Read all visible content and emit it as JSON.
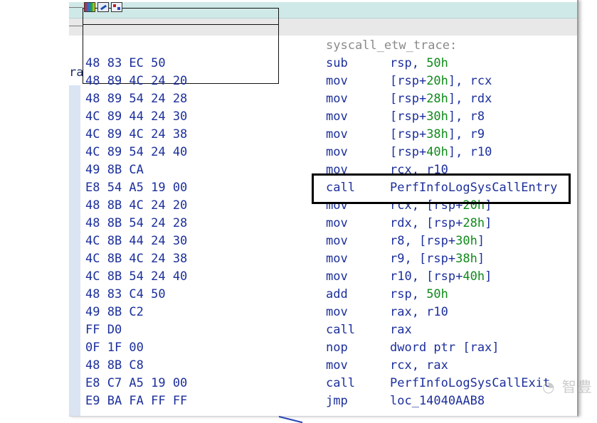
{
  "fragment": {
    "left_text": "ra"
  },
  "function_label": "syscall_etw_trace:",
  "instructions": [
    {
      "bytes": "48 83 EC 50",
      "mnemonic": "sub",
      "ops": [
        {
          "t": "rsp, "
        },
        {
          "t": "50h",
          "num": true
        }
      ]
    },
    {
      "bytes": "48 89 4C 24 20",
      "mnemonic": "mov",
      "ops": [
        {
          "t": "[rsp+"
        },
        {
          "t": "20h",
          "num": true
        },
        {
          "t": "], rcx"
        }
      ]
    },
    {
      "bytes": "48 89 54 24 28",
      "mnemonic": "mov",
      "ops": [
        {
          "t": "[rsp+"
        },
        {
          "t": "28h",
          "num": true
        },
        {
          "t": "], rdx"
        }
      ]
    },
    {
      "bytes": "4C 89 44 24 30",
      "mnemonic": "mov",
      "ops": [
        {
          "t": "[rsp+"
        },
        {
          "t": "30h",
          "num": true
        },
        {
          "t": "], r8"
        }
      ]
    },
    {
      "bytes": "4C 89 4C 24 38",
      "mnemonic": "mov",
      "ops": [
        {
          "t": "[rsp+"
        },
        {
          "t": "38h",
          "num": true
        },
        {
          "t": "], r9"
        }
      ]
    },
    {
      "bytes": "4C 89 54 24 40",
      "mnemonic": "mov",
      "ops": [
        {
          "t": "[rsp+"
        },
        {
          "t": "40h",
          "num": true
        },
        {
          "t": "], r10"
        }
      ]
    },
    {
      "bytes": "49 8B CA",
      "mnemonic": "mov",
      "ops": [
        {
          "t": "rcx, r10"
        }
      ]
    },
    {
      "bytes": "E8 54 A5 19 00",
      "mnemonic": "call",
      "ops": [
        {
          "t": "PerfInfoLogSysCallEntry"
        }
      ]
    },
    {
      "bytes": "48 8B 4C 24 20",
      "mnemonic": "mov",
      "ops": [
        {
          "t": "rcx, [rsp+"
        },
        {
          "t": "20h",
          "num": true
        },
        {
          "t": "]"
        }
      ]
    },
    {
      "bytes": "48 8B 54 24 28",
      "mnemonic": "mov",
      "ops": [
        {
          "t": "rdx, [rsp+"
        },
        {
          "t": "28h",
          "num": true
        },
        {
          "t": "]"
        }
      ]
    },
    {
      "bytes": "4C 8B 44 24 30",
      "mnemonic": "mov",
      "ops": [
        {
          "t": "r8, [rsp+"
        },
        {
          "t": "30h",
          "num": true
        },
        {
          "t": "]"
        }
      ]
    },
    {
      "bytes": "4C 8B 4C 24 38",
      "mnemonic": "mov",
      "ops": [
        {
          "t": "r9, [rsp+"
        },
        {
          "t": "38h",
          "num": true
        },
        {
          "t": "]"
        }
      ]
    },
    {
      "bytes": "4C 8B 54 24 40",
      "mnemonic": "mov",
      "ops": [
        {
          "t": "r10, [rsp+"
        },
        {
          "t": "40h",
          "num": true
        },
        {
          "t": "]"
        }
      ]
    },
    {
      "bytes": "48 83 C4 50",
      "mnemonic": "add",
      "ops": [
        {
          "t": "rsp, "
        },
        {
          "t": "50h",
          "num": true
        }
      ]
    },
    {
      "bytes": "49 8B C2",
      "mnemonic": "mov",
      "ops": [
        {
          "t": "rax, r10"
        }
      ]
    },
    {
      "bytes": "FF D0",
      "mnemonic": "call",
      "ops": [
        {
          "t": "rax"
        }
      ]
    },
    {
      "bytes": "0F 1F 00",
      "mnemonic": "nop",
      "ops": [
        {
          "t": "dword ptr [rax]"
        }
      ]
    },
    {
      "bytes": "48 8B C8",
      "mnemonic": "mov",
      "ops": [
        {
          "t": "rcx, rax"
        }
      ]
    },
    {
      "bytes": "E8 C7 A5 19 00",
      "mnemonic": "call",
      "ops": [
        {
          "t": "PerfInfoLogSysCallExit"
        }
      ]
    },
    {
      "bytes": "E9 BA FA FF FF",
      "mnemonic": "jmp",
      "ops": [
        {
          "t": "loc_14040AAB8"
        }
      ]
    }
  ],
  "highlighted_index": 7,
  "icons": [
    "color-palette-icon",
    "edit-node-icon",
    "graph-overview-icon"
  ],
  "colors": {
    "code_blue": "#1c2f9c",
    "number_green": "#0f8a1a",
    "label_gray": "#8a8a8a",
    "titlebar": "#cfe9e8"
  }
}
